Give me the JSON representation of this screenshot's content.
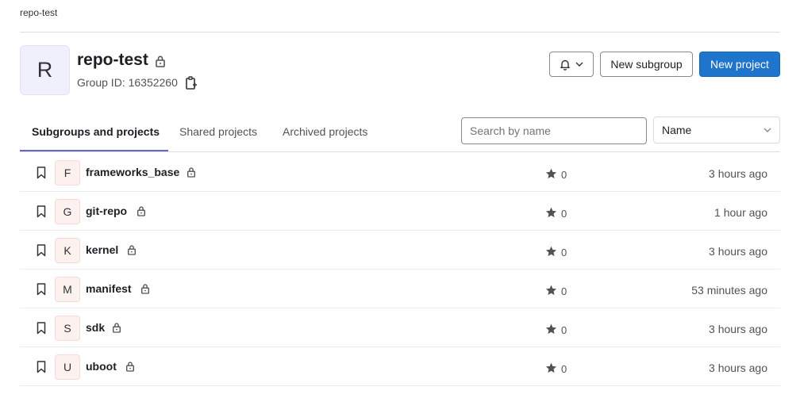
{
  "breadcrumb": "repo-test",
  "group": {
    "avatar_letter": "R",
    "name": "repo-test",
    "id_text": "Group ID: 16352260"
  },
  "actions": {
    "new_subgroup": "New subgroup",
    "new_project": "New project"
  },
  "tabs": [
    {
      "label": "Subgroups and projects",
      "active": true
    },
    {
      "label": "Shared projects",
      "active": false
    },
    {
      "label": "Archived projects",
      "active": false
    }
  ],
  "search": {
    "placeholder": "Search by name"
  },
  "sort": {
    "selected": "Name"
  },
  "projects": [
    {
      "letter": "F",
      "name": "frameworks_base",
      "stars": "0",
      "updated": "3 hours ago"
    },
    {
      "letter": "G",
      "name": "git-repo",
      "stars": "0",
      "updated": "1 hour ago"
    },
    {
      "letter": "K",
      "name": "kernel",
      "stars": "0",
      "updated": "3 hours ago"
    },
    {
      "letter": "M",
      "name": "manifest",
      "stars": "0",
      "updated": "53 minutes ago"
    },
    {
      "letter": "S",
      "name": "sdk",
      "stars": "0",
      "updated": "3 hours ago"
    },
    {
      "letter": "U",
      "name": "uboot",
      "stars": "0",
      "updated": "3 hours ago"
    }
  ],
  "colors": {
    "primary": "#1f75cb",
    "tab_indicator": "#6666c4"
  }
}
